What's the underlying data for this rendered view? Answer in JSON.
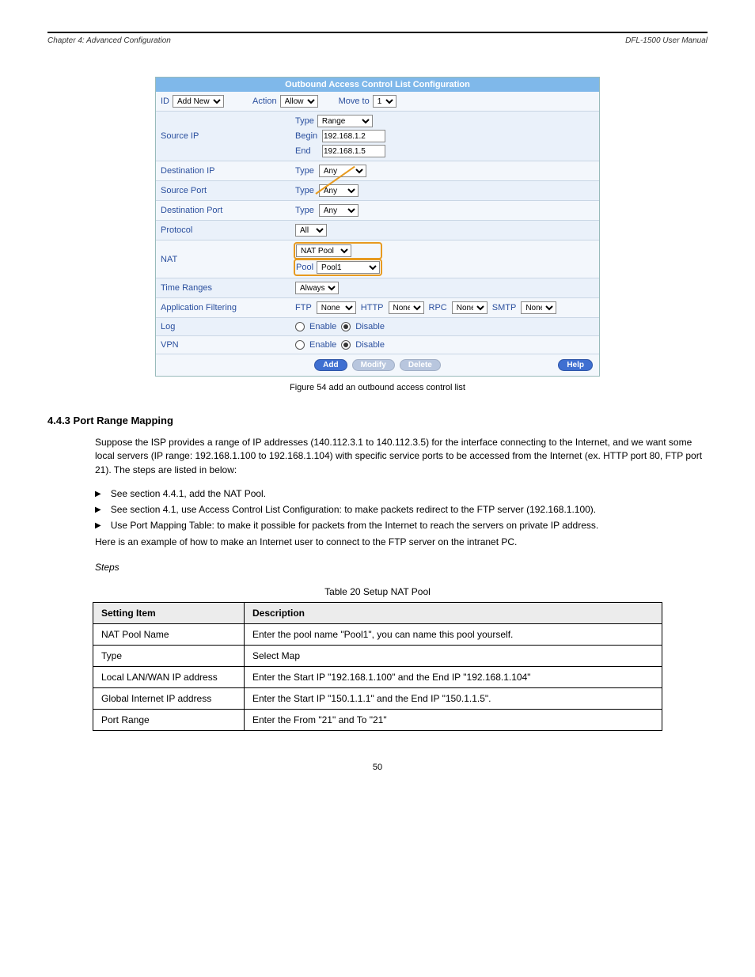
{
  "header": {
    "left": "Chapter 4: Advanced Configuration",
    "right": "DFL-1500 User Manual"
  },
  "figure": {
    "title": "Outbound Access Control List Configuration",
    "top": {
      "id_label": "ID",
      "id_value": "Add New",
      "action_label": "Action",
      "action_value": "Allow",
      "move_label": "Move to",
      "move_value": "1"
    },
    "rows": {
      "source_ip": {
        "label": "Source IP",
        "type_label": "Type",
        "type_value": "Range",
        "begin_label": "Begin",
        "begin_value": "192.168.1.2",
        "end_label": "End",
        "end_value": "192.168.1.5"
      },
      "dest_ip": {
        "label": "Destination IP",
        "type_label": "Type",
        "type_value": "Any"
      },
      "source_port": {
        "label": "Source Port",
        "type_label": "Type",
        "type_value": "Any"
      },
      "dest_port": {
        "label": "Destination Port",
        "type_label": "Type",
        "type_value": "Any"
      },
      "protocol": {
        "label": "Protocol",
        "value": "All"
      },
      "nat": {
        "label": "NAT",
        "mode": "NAT Pool",
        "pool_label": "Pool",
        "pool_value": "Pool1"
      },
      "time_ranges": {
        "label": "Time Ranges",
        "value": "Always"
      },
      "app_filter": {
        "label": "Application Filtering",
        "ftp_label": "FTP",
        "ftp_value": "None",
        "http_label": "HTTP",
        "http_value": "None",
        "rpc_label": "RPC",
        "rpc_value": "None",
        "smtp_label": "SMTP",
        "smtp_value": "None"
      },
      "log": {
        "label": "Log",
        "enable": "Enable",
        "disable": "Disable"
      },
      "vpn": {
        "label": "VPN",
        "enable": "Enable",
        "disable": "Disable"
      }
    },
    "buttons": {
      "add": "Add",
      "modify": "Modify",
      "delete": "Delete",
      "help": "Help"
    },
    "caption": "Figure 54 add an outbound access control list"
  },
  "section": {
    "heading": "4.4.3 Port Range Mapping",
    "intro": "Suppose the ISP provides a range of IP addresses (140.112.3.1 to 140.112.3.5) for the interface connecting to the Internet, and we want some local servers (IP range: 192.168.1.100 to 192.168.1.104) with specific service ports to be accessed from the Internet (ex. HTTP port 80, FTP port 21). The steps are listed in below:",
    "bullets": [
      "See section 4.4.1, add the NAT Pool.",
      "See section 4.1, use Access Control List Configuration: to make packets redirect to the FTP server (192.168.1.100).",
      "Use Port Mapping Table: to make it possible for packets from the Internet to reach the servers on private IP address."
    ],
    "example_intro": "Here is an example of how to make an Internet user to connect to the FTP server on the intranet PC.",
    "steps_heading": "Steps",
    "table_caption": "Table 20 Setup NAT Pool"
  },
  "table": {
    "head": {
      "c1": "Setting Item",
      "c2": "Description"
    },
    "rows": [
      {
        "c1": "NAT Pool Name",
        "c2": "Enter the pool name \"Pool1\", you can name this pool yourself."
      },
      {
        "c1": "Type",
        "c2": "Select Map"
      },
      {
        "c1": "Local LAN/WAN IP address",
        "c2": "Enter the Start IP \"192.168.1.100\" and the End IP \"192.168.1.104\""
      },
      {
        "c1": "Global Internet IP address",
        "c2": "Enter the Start IP \"150.1.1.1\" and the End IP \"150.1.1.5\"."
      },
      {
        "c1": "Port Range",
        "c2": "Enter the From \"21\" and To \"21\""
      }
    ]
  },
  "page_number": "50"
}
